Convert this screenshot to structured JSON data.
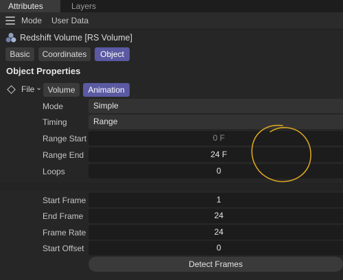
{
  "tabs": [
    {
      "label": "Attributes",
      "active": true
    },
    {
      "label": "Layers",
      "active": false
    }
  ],
  "menu": {
    "icon": "hamburger-menu-icon",
    "items": [
      "Mode",
      "User Data"
    ]
  },
  "object": {
    "icon": "redshift-volume-icon",
    "title": "Redshift Volume [RS Volume]",
    "tabs": [
      {
        "label": "Basic",
        "selected": false
      },
      {
        "label": "Coordinates",
        "selected": false
      },
      {
        "label": "Object",
        "selected": true
      }
    ]
  },
  "section_title": "Object Properties",
  "file_row": {
    "label": "File",
    "tabs": [
      {
        "label": "Volume",
        "selected": false
      },
      {
        "label": "Animation",
        "selected": true
      }
    ]
  },
  "properties": [
    {
      "label": "Mode",
      "value": "Simple",
      "kind": "dropdown"
    },
    {
      "label": "Timing",
      "value": "Range",
      "kind": "dropdown"
    },
    {
      "label": "Range Start",
      "value": "0 F",
      "kind": "field",
      "muted": true
    },
    {
      "label": "Range End",
      "value": "24 F",
      "kind": "field"
    },
    {
      "label": "Loops",
      "value": "0",
      "kind": "field"
    },
    {
      "label": "Start Frame",
      "value": "1",
      "kind": "field"
    },
    {
      "label": "End Frame",
      "value": "24",
      "kind": "field"
    },
    {
      "label": "Frame Rate",
      "value": "24",
      "kind": "field"
    },
    {
      "label": "Start Offset",
      "value": "0",
      "kind": "field"
    }
  ],
  "detect_button": "Detect Frames",
  "colors": {
    "accent": "#5a59a2",
    "annotation": "#d9a520",
    "background": "#262626"
  }
}
